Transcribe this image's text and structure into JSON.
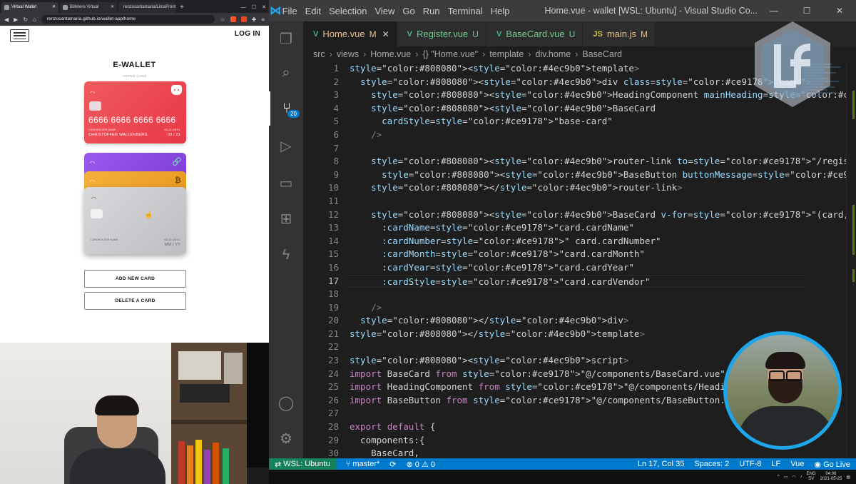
{
  "browser": {
    "tabs": [
      {
        "label": "Virtual Wallet",
        "active": true
      },
      {
        "label": "Billetera Virtual",
        "active": false
      },
      {
        "label": "renzosantamaria/LimaFronte...",
        "active": false
      }
    ],
    "url": "renzosantamaria.github.io/wallet-app/home"
  },
  "wallet_app": {
    "login": "LOG IN",
    "heading": "E-WALLET",
    "subheading": "ACTIVE CARD",
    "active_card": {
      "number": "6666 6666 6666 6666",
      "holder_label": "CARDHOLDER NAME",
      "holder": "CHRISTOFFER WALLENBERG",
      "valid_label": "VALID UNTIL",
      "valid": "03 / 21",
      "color": "#e83845"
    },
    "stack_cards": [
      {
        "vendor": "purple",
        "color": "#8b4be6"
      },
      {
        "vendor": "bitcoin",
        "color": "#f0a52a"
      }
    ],
    "blank_card": {
      "holder_label": "CARDHOLDER NAME",
      "valid_label": "VALID UNTIL",
      "valid": "MM / YY"
    },
    "buttons": {
      "add": "ADD NEW CARD",
      "delete": "DELETE A CARD"
    }
  },
  "vscode": {
    "menu": [
      "File",
      "Edit",
      "Selection",
      "View",
      "Go",
      "Run",
      "Terminal",
      "Help"
    ],
    "window_title": "Home.vue - wallet [WSL: Ubuntu] - Visual Studio Co...",
    "scm_badge": "20",
    "tabs": [
      {
        "icon": "V",
        "name": "Home.vue",
        "status": "M",
        "active": true
      },
      {
        "icon": "V",
        "name": "Register.vue",
        "status": "U",
        "active": false
      },
      {
        "icon": "V",
        "name": "BaseCard.vue",
        "status": "U",
        "active": false
      },
      {
        "icon": "JS",
        "name": "main.js",
        "status": "M",
        "active": false
      }
    ],
    "breadcrumbs": [
      "src",
      "views",
      "Home.vue",
      "{} \"Home.vue\"",
      "template",
      "div.home",
      "BaseCard"
    ],
    "current_line": 17,
    "lines": [
      {
        "n": "1",
        "t": "<template>"
      },
      {
        "n": "2",
        "t": "  <div class=\"home\">"
      },
      {
        "n": "3",
        "t": "    <HeadingComponent mainHeading=\"E-wallet\" secondaryHeading=\"active card\" />"
      },
      {
        "n": "4",
        "t": "    <BaseCard"
      },
      {
        "n": "5",
        "t": "      cardStyle=\"base-card\""
      },
      {
        "n": "6",
        "t": "    />"
      },
      {
        "n": "7",
        "t": ""
      },
      {
        "n": "8",
        "t": "    <router-link to=\"/register\">"
      },
      {
        "n": "9",
        "t": "      <BaseButton buttonMessage=\"Add card\" />"
      },
      {
        "n": "10",
        "t": "    </router-link>"
      },
      {
        "n": "11",
        "t": ""
      },
      {
        "n": "12",
        "t": "    <BaseCard v-for=\"(card, index) in cards\" :key=\"index\""
      },
      {
        "n": "13",
        "t": "      :cardName=\"card.cardName\""
      },
      {
        "n": "14",
        "t": "      :cardNumber=\" card.cardNumber\""
      },
      {
        "n": "15",
        "t": "      :cardMonth=\"card.cardMonth\""
      },
      {
        "n": "16",
        "t": "      :cardYear=\"card.cardYear\""
      },
      {
        "n": "17",
        "t": "      :cardStyle=\"card.cardVendor\""
      },
      {
        "n": "18",
        "t": ""
      },
      {
        "n": "19",
        "t": "    />"
      },
      {
        "n": "20",
        "t": "  </div>"
      },
      {
        "n": "21",
        "t": "</template>"
      },
      {
        "n": "22",
        "t": ""
      },
      {
        "n": "23",
        "t": "<script>"
      },
      {
        "n": "24",
        "t": "import BaseCard from \"@/components/BaseCard.vue\";"
      },
      {
        "n": "25",
        "t": "import HeadingComponent from \"@/components/HeadingComponent.vue\";"
      },
      {
        "n": "26",
        "t": "import BaseButton from \"@/components/BaseButton.vue\";"
      },
      {
        "n": "27",
        "t": ""
      },
      {
        "n": "28",
        "t": "export default {"
      },
      {
        "n": "29",
        "t": "  components:{"
      },
      {
        "n": "30",
        "t": "    BaseCard,"
      }
    ],
    "status": {
      "remote": "WSL: Ubuntu",
      "branch": "master*",
      "problems": "0",
      "warnings": "0",
      "position": "Ln 17, Col 35",
      "spaces": "Spaces: 2",
      "encoding": "UTF-8",
      "eol": "LF",
      "language": "Vue",
      "golive": "Go Live"
    },
    "taskbar": {
      "lang": "ENG",
      "region": "SV",
      "time": "04:06",
      "date": "2021-05-25"
    }
  }
}
